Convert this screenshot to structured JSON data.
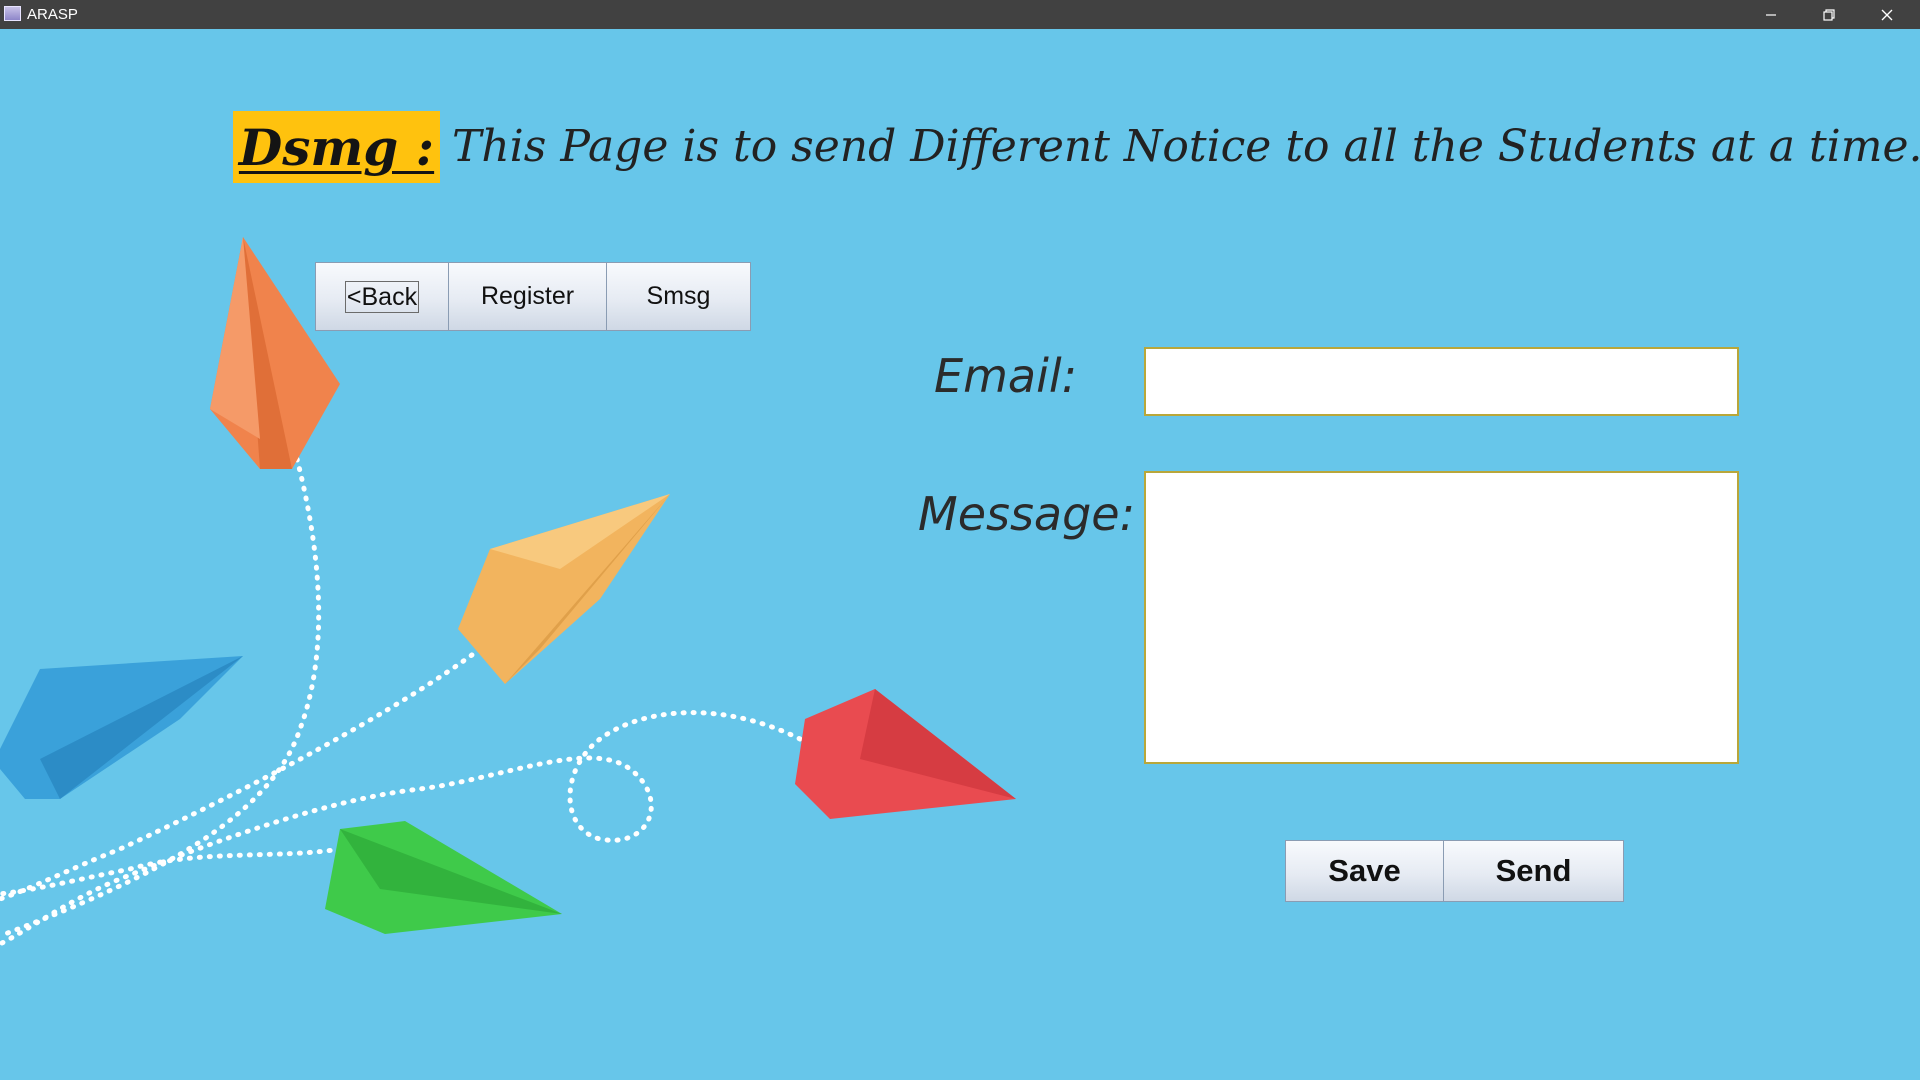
{
  "window": {
    "title": "ARASP",
    "app_icon": "app-icon",
    "controls": [
      "minimize-icon",
      "restore-icon",
      "close-icon"
    ]
  },
  "header": {
    "tag": "Dsmg :",
    "tag_color": "#ffc20e",
    "description": "This Page is to send Different Notice to all the Students at a time."
  },
  "nav": {
    "back": "<Back",
    "register": "Register",
    "smsg": "Smsg"
  },
  "form": {
    "email_label": "Email:",
    "email_value": "",
    "message_label": "Message:",
    "message_value": ""
  },
  "actions": {
    "save": "Save",
    "send": "Send"
  },
  "colors": {
    "background": "#67c6ea",
    "titlebar": "#414141",
    "planes": [
      "#f0834c",
      "#f2b45e",
      "#3aa1da",
      "#e94b50",
      "#3fca4a"
    ]
  }
}
